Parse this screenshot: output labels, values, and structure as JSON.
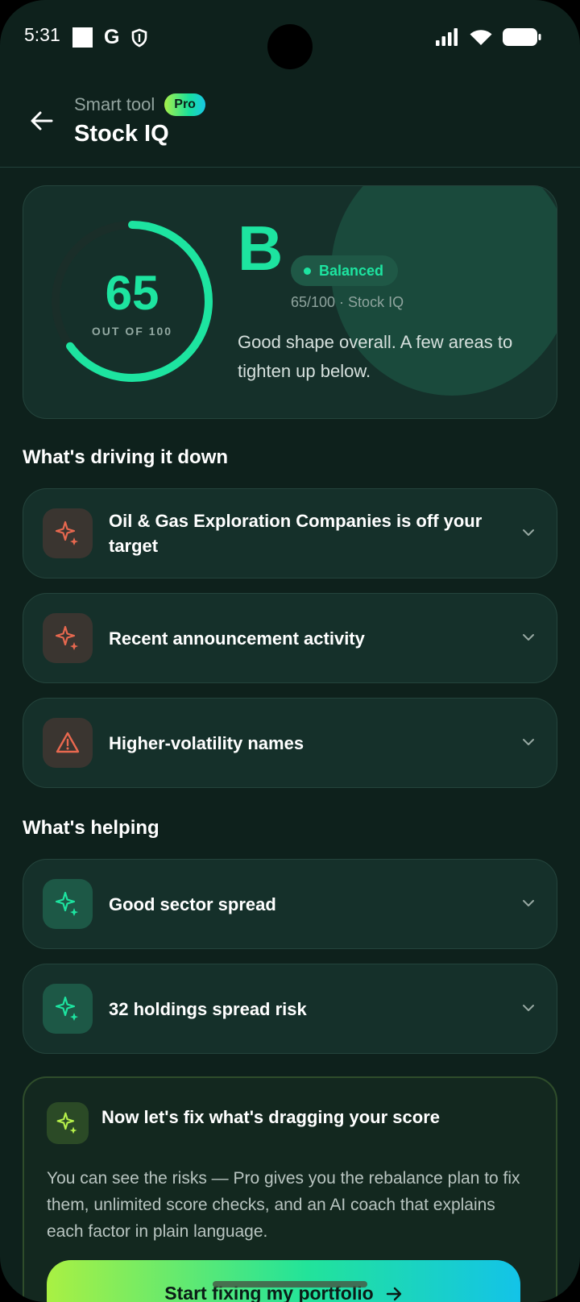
{
  "status_bar": {
    "time": "5:31"
  },
  "header": {
    "subtitle": "Smart tool",
    "badge": "Pro",
    "title": "Stock IQ"
  },
  "score": {
    "value": 65,
    "max": 100,
    "value_text": "65",
    "out_of_label": "OUT OF 100",
    "grade": "B",
    "status": "Balanced",
    "meta": "65/100 · Stock IQ",
    "description": "Good shape overall. A few areas to tighten up below.",
    "colors": {
      "accent": "#1de4a0",
      "track": "#1a2e29"
    }
  },
  "driving_down": {
    "heading": "What's driving it down",
    "items": [
      {
        "label": "Oil & Gas Exploration Companies is off your target",
        "icon": "sparkle-icon"
      },
      {
        "label": "Recent announcement activity",
        "icon": "sparkle-icon"
      },
      {
        "label": "Higher-volatility names",
        "icon": "warning-icon"
      }
    ]
  },
  "helping": {
    "heading": "What's helping",
    "items": [
      {
        "label": "Good sector spread",
        "icon": "sparkle-icon"
      },
      {
        "label": "32 holdings spread risk",
        "icon": "sparkle-icon"
      }
    ]
  },
  "promo": {
    "title": "Now let's fix what's dragging your score",
    "body": "You can see the risks — Pro gives you the rebalance plan to fix them, unlimited score checks, and an AI coach that explains each factor in plain language.",
    "cta": "Start fixing my portfolio"
  }
}
